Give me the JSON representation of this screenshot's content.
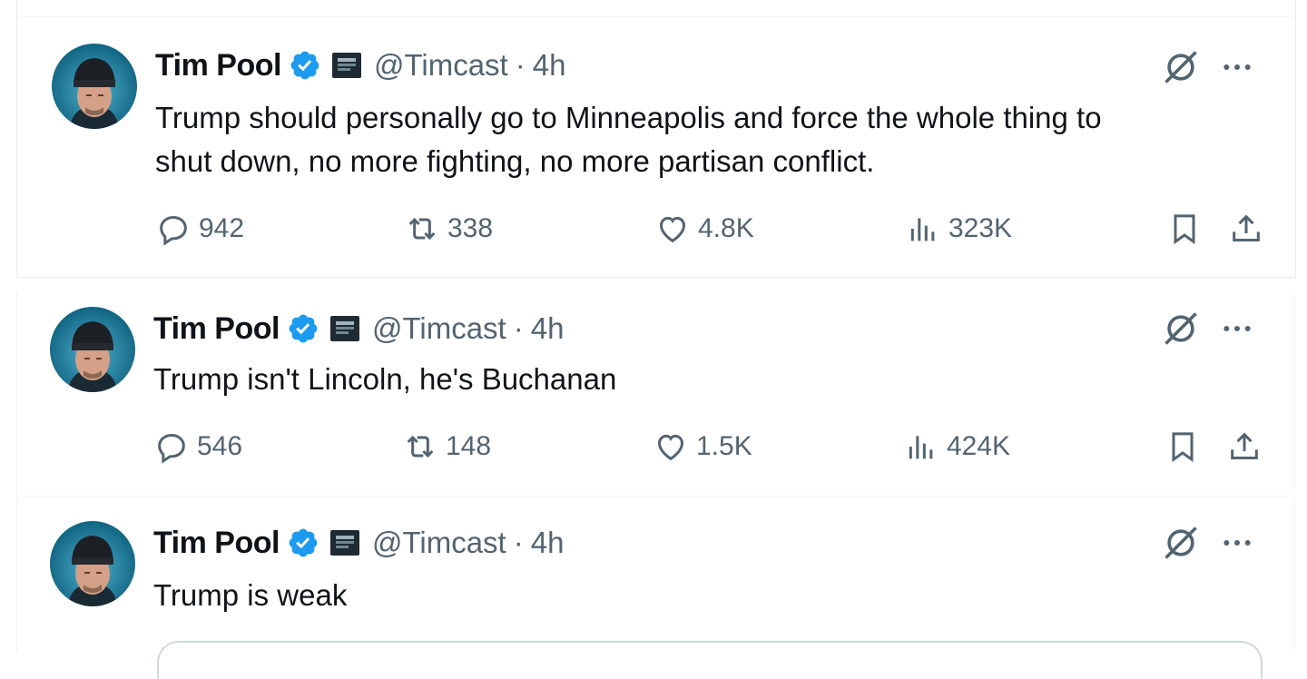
{
  "colors": {
    "verified": "#1d9bf0",
    "muted": "#536471",
    "text": "#0f1419",
    "border": "#eff3f4"
  },
  "icons": {
    "reply": "speech-bubble-icon",
    "repost": "repost-arrows-icon",
    "like": "heart-icon",
    "views": "bar-chart-icon",
    "bookmark": "bookmark-icon",
    "share": "share-upload-icon",
    "grok": "grok-slash-icon",
    "more": "more-dots-icon",
    "verified": "verified-badge-icon"
  },
  "posts": [
    {
      "name": "Tim Pool",
      "handle": "@Timcast",
      "separator": "·",
      "time": "4h",
      "lines": [
        "Trump should personally go to Minneapolis and force the whole thing to",
        "shut down, no more fighting, no more partisan conflict."
      ],
      "replies": "942",
      "reposts": "338",
      "likes": "4.8K",
      "views": "323K"
    },
    {
      "name": "Tim Pool",
      "handle": "@Timcast",
      "separator": "·",
      "time": "4h",
      "lines": [
        "Trump isn't Lincoln, he's Buchanan"
      ],
      "replies": "546",
      "reposts": "148",
      "likes": "1.5K",
      "views": "424K"
    },
    {
      "name": "Tim Pool",
      "handle": "@Timcast",
      "separator": "·",
      "time": "4h",
      "lines": [
        "Trump is weak"
      ]
    }
  ]
}
